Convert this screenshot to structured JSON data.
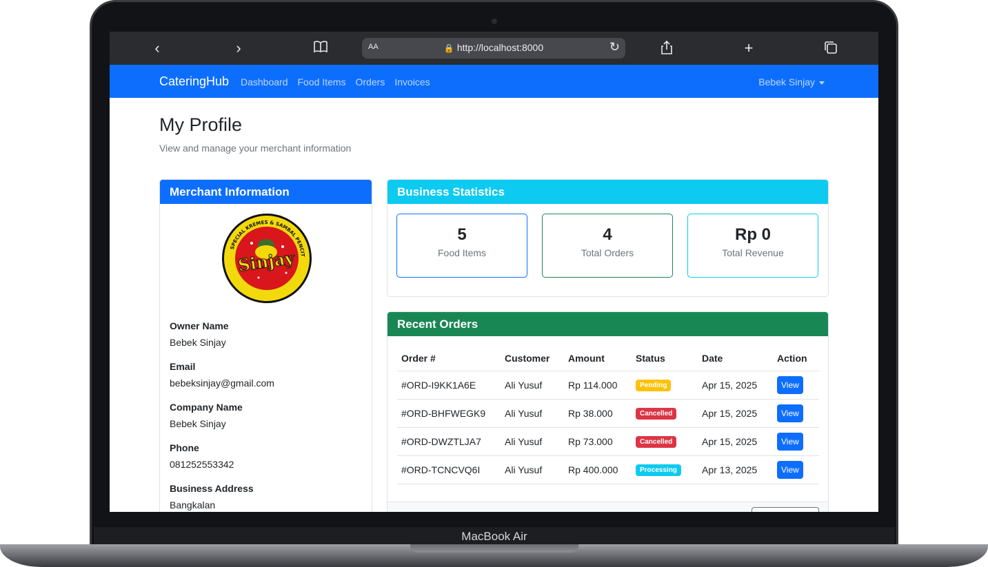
{
  "device": {
    "label": "MacBook Air"
  },
  "browser": {
    "url": "http://localhost:8000",
    "text_size_label": "AA"
  },
  "navbar": {
    "brand": "CateringHub",
    "links": [
      "Dashboard",
      "Food Items",
      "Orders",
      "Invoices"
    ],
    "user": "Bebek Sinjay"
  },
  "page": {
    "title": "My Profile",
    "subtitle": "View and manage your merchant information"
  },
  "merchant": {
    "header": "Merchant Information",
    "logo_text": "Sinjay",
    "logo_ring_text": "SPECIAL KREMES & SAMBAL PENCIT",
    "fields": [
      {
        "label": "Owner Name",
        "value": "Bebek Sinjay"
      },
      {
        "label": "Email",
        "value": "bebeksinjay@gmail.com"
      },
      {
        "label": "Company Name",
        "value": "Bebek Sinjay"
      },
      {
        "label": "Phone",
        "value": "081252553342"
      },
      {
        "label": "Business Address",
        "value": "Bangkalan"
      }
    ]
  },
  "stats": {
    "header": "Business Statistics",
    "items": [
      {
        "value": "5",
        "label": "Food Items",
        "border": "#0d6efd"
      },
      {
        "value": "4",
        "label": "Total Orders",
        "border": "#198754"
      },
      {
        "value": "Rp 0",
        "label": "Total Revenue",
        "border": "#0dcaf0"
      }
    ]
  },
  "orders": {
    "header": "Recent Orders",
    "columns": [
      "Order #",
      "Customer",
      "Amount",
      "Status",
      "Date",
      "Action"
    ],
    "rows": [
      {
        "id": "#ORD-I9KK1A6E",
        "customer": "Ali Yusuf",
        "amount": "Rp 114.000",
        "status": "Pending",
        "date": "Apr 15, 2025",
        "action": "View"
      },
      {
        "id": "#ORD-BHFWEGK9",
        "customer": "Ali Yusuf",
        "amount": "Rp 38.000",
        "status": "Cancelled",
        "date": "Apr 15, 2025",
        "action": "View"
      },
      {
        "id": "#ORD-DWZTLJA7",
        "customer": "Ali Yusuf",
        "amount": "Rp 73.000",
        "status": "Cancelled",
        "date": "Apr 15, 2025",
        "action": "View"
      },
      {
        "id": "#ORD-TCNCVQ6I",
        "customer": "Ali Yusuf",
        "amount": "Rp 400.000",
        "status": "Processing",
        "date": "Apr 13, 2025",
        "action": "View"
      }
    ]
  },
  "colors": {
    "primary": "#0d6efd",
    "info": "#0dcaf0",
    "success": "#198754",
    "warning": "#ffc107",
    "danger": "#dc3545"
  },
  "icons": [
    "back-icon",
    "forward-icon",
    "book-icon",
    "lock-icon",
    "reload-icon",
    "share-icon",
    "plus-icon",
    "tabs-icon",
    "caret-down-icon"
  ]
}
